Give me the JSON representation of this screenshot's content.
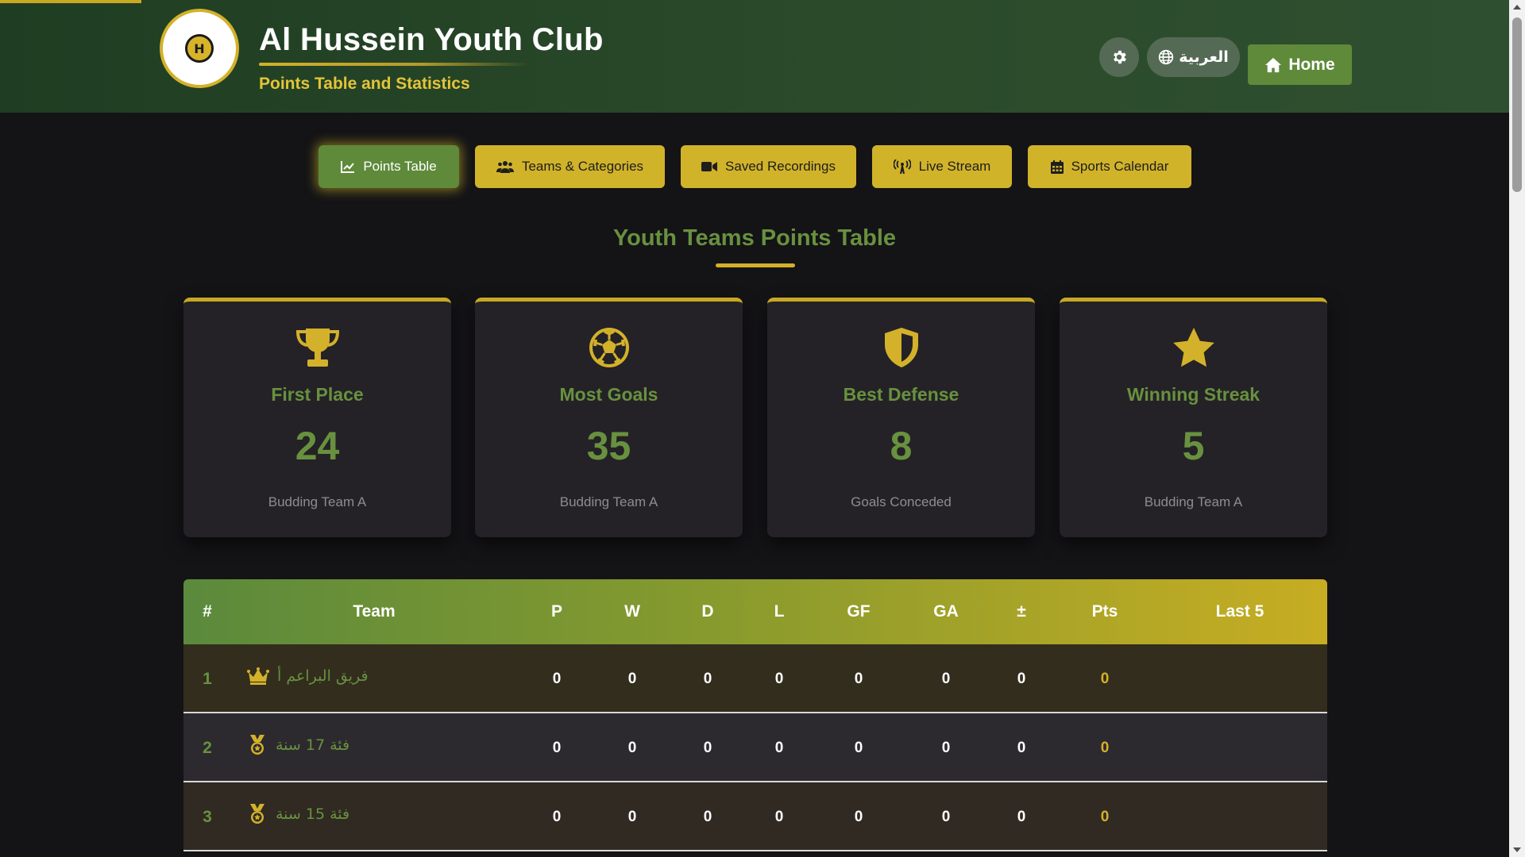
{
  "header": {
    "logo_text": "H",
    "title": "Al Hussein Youth Club",
    "subtitle": "Points Table and Statistics",
    "language_label": "العربية",
    "home_label": "Home"
  },
  "nav": {
    "items": [
      {
        "label": "Points Table",
        "icon": "chart-line-icon",
        "active": true
      },
      {
        "label": "Teams & Categories",
        "icon": "users-icon",
        "active": false
      },
      {
        "label": "Saved Recordings",
        "icon": "video-camera-icon",
        "active": false
      },
      {
        "label": "Live Stream",
        "icon": "broadcast-tower-icon",
        "active": false
      },
      {
        "label": "Sports Calendar",
        "icon": "calendar-icon",
        "active": false
      }
    ]
  },
  "section": {
    "title": "Youth Teams Points Table"
  },
  "stats": [
    {
      "icon": "trophy-icon",
      "label": "First Place",
      "value": "24",
      "sub": "Budding Team A"
    },
    {
      "icon": "soccer-ball-icon",
      "label": "Most Goals",
      "value": "35",
      "sub": "Budding Team A"
    },
    {
      "icon": "shield-icon",
      "label": "Best Defense",
      "value": "8",
      "sub": "Goals Conceded"
    },
    {
      "icon": "star-icon",
      "label": "Winning Streak",
      "value": "5",
      "sub": "Budding Team A"
    }
  ],
  "table": {
    "headers": [
      "#",
      "Team",
      "P",
      "W",
      "D",
      "L",
      "GF",
      "GA",
      "±",
      "Pts",
      "Last 5"
    ],
    "rows": [
      {
        "rank": "1",
        "team": "فريق البراعم أ",
        "badge": "crown-icon",
        "p": "0",
        "w": "0",
        "d": "0",
        "l": "0",
        "gf": "0",
        "ga": "0",
        "gd": "0",
        "pts": "0",
        "last5": ""
      },
      {
        "rank": "2",
        "team": "فئة 17 سنة",
        "badge": "medal-icon",
        "p": "0",
        "w": "0",
        "d": "0",
        "l": "0",
        "gf": "0",
        "ga": "0",
        "gd": "0",
        "pts": "0",
        "last5": ""
      },
      {
        "rank": "3",
        "team": "فئة 15 سنة",
        "badge": "medal-icon",
        "p": "0",
        "w": "0",
        "d": "0",
        "l": "0",
        "gf": "0",
        "ga": "0",
        "gd": "0",
        "pts": "0",
        "last5": ""
      }
    ]
  },
  "colors": {
    "header_green": "#2a4a2a",
    "accent_gold": "#d3b12a",
    "accent_green": "#68913f",
    "button_green": "#5e8a3a",
    "background": "#141316",
    "card_background": "#242226"
  }
}
